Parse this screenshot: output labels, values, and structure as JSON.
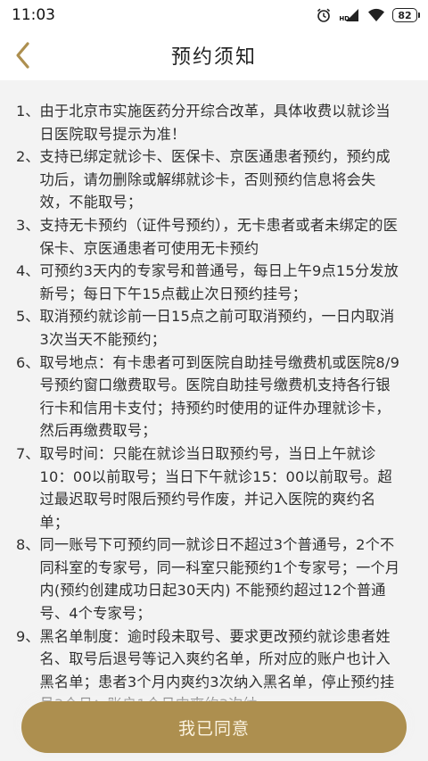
{
  "status_bar": {
    "time": "11:03",
    "network_label": "HD",
    "battery": "82"
  },
  "header": {
    "title": "预约须知",
    "back_icon": "chevron-left-icon",
    "accent_color": "#ad8f4f"
  },
  "notices": [
    {
      "num": "1、",
      "text": "由于北京市实施医药分开综合改革，具体收费以就诊当日医院取号提示为准！"
    },
    {
      "num": "2、",
      "text": "支持已绑定就诊卡、医保卡、京医通患者预约，预约成功后，请勿删除或解绑就诊卡，否则预约信息将会失效，不能取号；"
    },
    {
      "num": "3、",
      "text": "支持无卡预约（证件号预约），无卡患者或者未绑定的医保卡、京医通患者可使用无卡预约"
    },
    {
      "num": "4、",
      "text": "可预约3天内的专家号和普通号，每日上午9点15分发放新号；每日下午15点截止次日预约挂号；"
    },
    {
      "num": "5、",
      "text": "取消预约就诊前一日15点之前可取消预约，一日内取消3次当天不能预约；"
    },
    {
      "num": "6、",
      "text": "取号地点：有卡患者可到医院自助挂号缴费机或医院8/9号预约窗口缴费取号。医院自助挂号缴费机支持各行银行卡和信用卡支付；持预约时使用的证件办理就诊卡，然后再缴费取号；"
    },
    {
      "num": "7、",
      "text": "取号时间：只能在就诊当日取预约号，当日上午就诊10：00以前取号；当日下午就诊15：00以前取号。超过最迟取号时限后预约号作废，并记入医院的爽约名单；"
    },
    {
      "num": "8、",
      "text": "同一账号下可预约同一就诊日不超过3个普通号，2个不同科室的专家号，同一科室只能预约1个专家号；一个月内(预约创建成功日起30天内) 不能预约超过12个普通号、4个专家号；"
    },
    {
      "num": "9、",
      "text": "黑名单制度：逾时段未取号、要求更改预约就诊患者姓名、取号后退号等记入爽约名单，所对应的账户也计入黑名单；患者3个月内爽约3次纳入黑名单，停止预约挂号3个月；账户1个月内爽约3次纳"
    }
  ],
  "agree_button": {
    "label": "我已同意",
    "color": "#ad8f4f"
  }
}
